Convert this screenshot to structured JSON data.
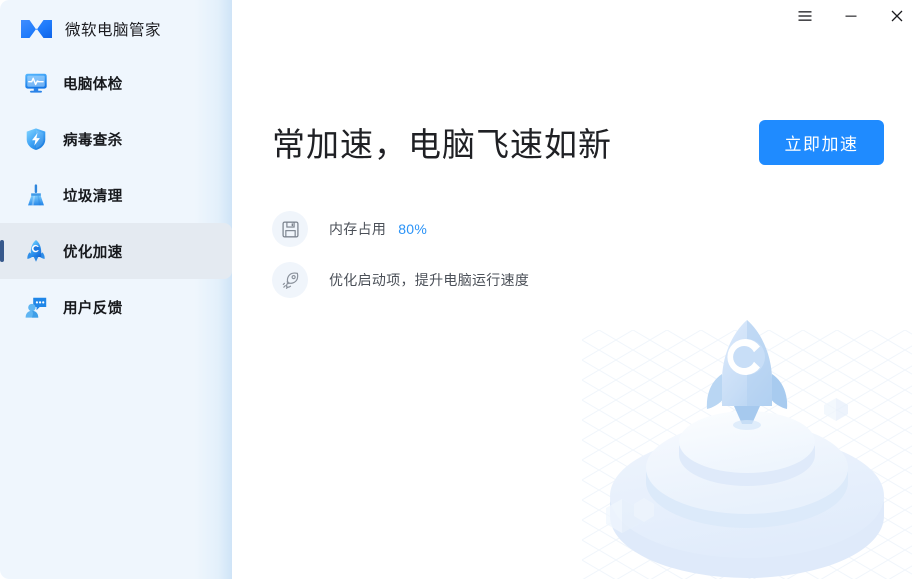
{
  "app": {
    "brand_name": "微软电脑管家",
    "logo_icon": "butterfly-logo-icon"
  },
  "titlebar": {
    "menu_icon": "hamburger-menu-icon",
    "minimize_icon": "minimize-icon",
    "close_icon": "close-icon"
  },
  "sidebar": {
    "items": [
      {
        "label": "电脑体检",
        "icon": "monitor-pulse-icon",
        "selected": false
      },
      {
        "label": "病毒查杀",
        "icon": "shield-bolt-icon",
        "selected": false
      },
      {
        "label": "垃圾清理",
        "icon": "broom-icon",
        "selected": false
      },
      {
        "label": "优化加速",
        "icon": "rocket-icon",
        "selected": true
      },
      {
        "label": "用户反馈",
        "icon": "user-feedback-icon",
        "selected": false
      }
    ]
  },
  "main": {
    "hero_title": "常加速，电脑飞速如新",
    "cta_label": "立即加速",
    "info_rows": [
      {
        "icon": "memory-chip-icon",
        "label": "内存占用",
        "value": "80%"
      },
      {
        "icon": "rocket-outline-icon",
        "label": "优化启动项，提升电脑运行速度",
        "value": ""
      }
    ],
    "illustration_icon": "rocket-platform-illustration"
  },
  "colors": {
    "accent": "#1f8bff",
    "value_blue": "#2b93f7",
    "sidebar_bg": "#eff6fd",
    "selected_bg": "#e4eaf1",
    "indicator": "#37598c"
  }
}
